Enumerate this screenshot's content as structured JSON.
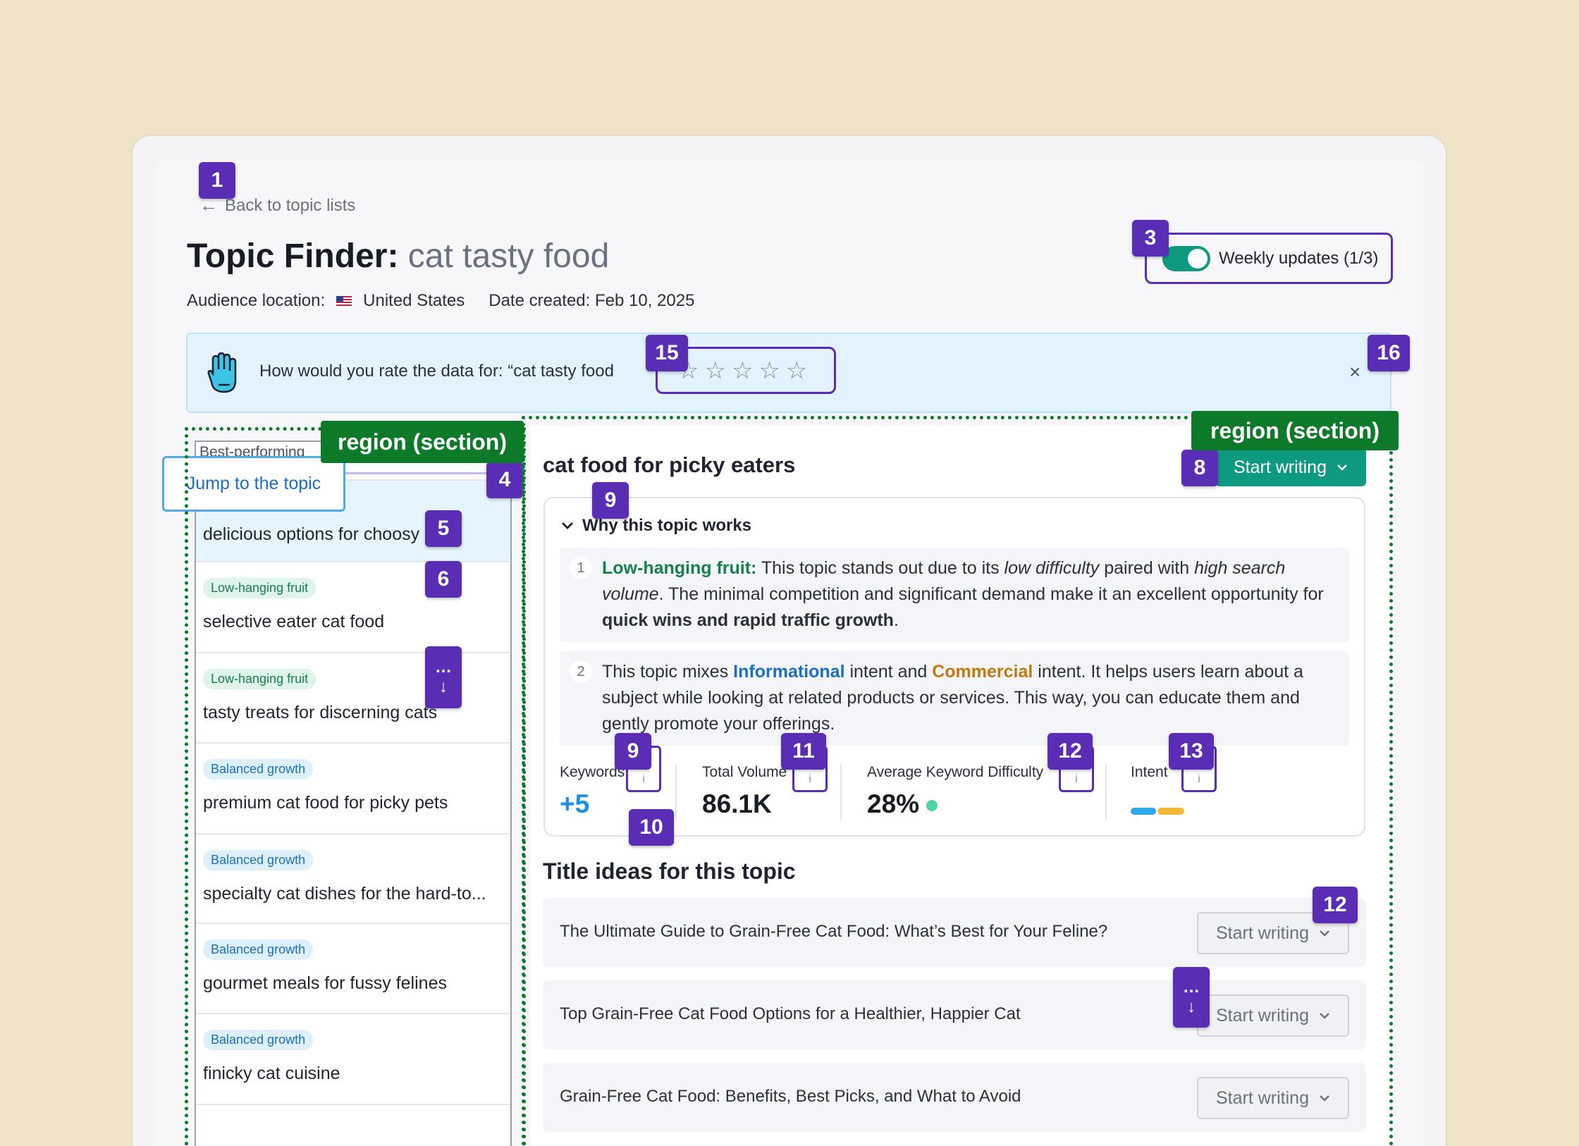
{
  "header": {
    "back_label": "Back to topic lists",
    "title_prefix": "Topic Finder:",
    "title_subject": "cat tasty food",
    "location_label": "Audience location:",
    "location_value": "United States",
    "date_label": "Date created: Feb 10, 2025",
    "toggle_label": "Weekly updates (1/3)",
    "toggle_on": true
  },
  "rating": {
    "prompt": "How would you rate the data for: “cat tasty food",
    "stars": [
      "☆",
      "☆",
      "☆",
      "☆",
      "☆"
    ],
    "close": "×"
  },
  "annotations": {
    "region_label": "region (section)",
    "badges": [
      "1",
      "3",
      "15",
      "16",
      "4",
      "5",
      "6",
      "8",
      "9",
      "9",
      "10",
      "11",
      "12",
      "13",
      "12"
    ],
    "more": "…",
    "down_arrow": "↓"
  },
  "topic_list": {
    "heading": "Best-performing",
    "jump_label": "Jump to the topic",
    "items": [
      {
        "tag": "",
        "label": "delicious options for choosy cats"
      },
      {
        "tag": "Low-hanging fruit",
        "label": "selective eater cat food"
      },
      {
        "tag": "Low-hanging fruit",
        "label": "tasty treats for discerning cats"
      },
      {
        "tag": "Balanced growth",
        "label": "premium cat food for picky pets"
      },
      {
        "tag": "Balanced growth",
        "label": "specialty cat dishes for the hard-to..."
      },
      {
        "tag": "Balanced growth",
        "label": "gourmet meals for fussy felines"
      },
      {
        "tag": "Balanced growth",
        "label": "finicky cat cuisine"
      }
    ]
  },
  "detail": {
    "topic_title": "cat food for picky eaters",
    "start_writing": "Start writing",
    "why_heading": "Why this topic works",
    "reasons": [
      {
        "num": "1",
        "lead": "Low-hanging fruit:",
        "t1": " This topic stands out due to its ",
        "em1": "low difficulty",
        "t2": " paired with ",
        "em2": "high search volume",
        "t3": ". The minimal competition and significant demand make it an excellent opportunity for ",
        "strong": "quick wins and rapid traffic growth",
        "t4": "."
      },
      {
        "num": "2",
        "t1": "This topic mixes ",
        "info": "Informational",
        "t2": " intent and ",
        "comm": "Commercial",
        "t3": " intent. It helps users learn about a subject while looking at related products or services. This way, you can educate them and gently promote your offerings."
      }
    ],
    "metrics": {
      "keywords_label": "Keywords",
      "keywords_value": "+5",
      "volume_label": "Total Volume",
      "volume_value": "86.1K",
      "difficulty_label": "Average Keyword Difficulty",
      "difficulty_value": "28%",
      "intent_label": "Intent",
      "info_icon": "i"
    },
    "ideas_heading": "Title ideas for this topic",
    "ideas": [
      "The Ultimate Guide to Grain-Free Cat Food: What’s Best for Your Feline?",
      "Top Grain-Free Cat Food Options for a Healthier, Happier Cat",
      "Grain-Free Cat Food: Benefits, Best Picks, and What to Avoid"
    ]
  },
  "colors": {
    "accent_teal": "#0d9a80",
    "badge_purple": "#5a2eb4",
    "region_green": "#0d7a2a",
    "informational_blue": "#1b6fbf",
    "commercial_orange": "#c2790d",
    "intent_bar_blue": "#2fa8e8",
    "intent_bar_yellow": "#f2b937"
  }
}
